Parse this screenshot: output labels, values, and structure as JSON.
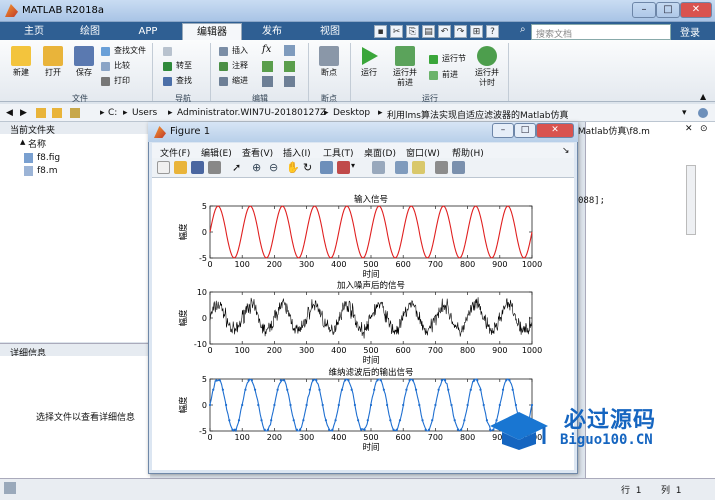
{
  "window": {
    "title": "MATLAB R2018a"
  },
  "search": {
    "placeholder": "搜索文档"
  },
  "login": "登录",
  "tabs": [
    {
      "label": "主页"
    },
    {
      "label": "绘图"
    },
    {
      "label": "APP"
    },
    {
      "label": "编辑器"
    },
    {
      "label": "发布"
    },
    {
      "label": "视图"
    }
  ],
  "ribbon": {
    "file": {
      "new": "新建",
      "open": "打开",
      "save": "保存",
      "find_files": "查找文件",
      "compare": "比较",
      "print": "打印",
      "group": "文件"
    },
    "nav": {
      "goto": "转至",
      "find": "查找",
      "group": "导航"
    },
    "edit": {
      "insert": "插入",
      "comment": "注释",
      "indent": "缩进",
      "fx": "fx",
      "group": "编辑"
    },
    "breakpoints": {
      "label": "断点",
      "group": "断点"
    },
    "run": {
      "run": "运行",
      "run_advance": "运行并\n前进",
      "run_section": "运行节",
      "advance": "前进",
      "run_time": "运行并\n计时",
      "group": "运行"
    }
  },
  "address": {
    "crumbs": [
      "C:",
      "Users",
      "Administrator.WIN7U-20180127Z",
      "Desktop",
      "利用lms算法实现自适应滤波器的Matlab仿真"
    ]
  },
  "left_pane": {
    "title": "当前文件夹",
    "name_header": "名称",
    "files": [
      "f8.fig",
      "f8.m"
    ]
  },
  "detail": {
    "title": "详细信息",
    "text": "选择文件以查看详细信息"
  },
  "editor": {
    "tab": "◎Matlab仿真\\f8.m",
    "code_fragment": "088];"
  },
  "status": {
    "row_label": "行",
    "row": "1",
    "col_label": "列",
    "col": "1"
  },
  "figure": {
    "title": "Figure 1",
    "menus": [
      "文件(F)",
      "编辑(E)",
      "查看(V)",
      "插入(I)",
      "工具(T)",
      "桌面(D)",
      "窗口(W)",
      "帮助(H)"
    ]
  },
  "chart_data": [
    {
      "type": "line",
      "title": "输入信号",
      "xlabel": "时间",
      "ylabel": "幅度",
      "xlim": [
        0,
        1000
      ],
      "ylim": [
        -5,
        5
      ],
      "xticks": [
        "0",
        "100",
        "200",
        "300",
        "400",
        "500",
        "600",
        "700",
        "800",
        "900",
        "1000"
      ],
      "yticks": [
        "5",
        "0",
        "-5"
      ],
      "series": [
        {
          "color": "#e02020",
          "amplitude": 5,
          "period": 100,
          "noise": 0
        }
      ]
    },
    {
      "type": "line",
      "title": "加入噪声后的信号",
      "xlabel": "时间",
      "ylabel": "幅度",
      "xlim": [
        0,
        1000
      ],
      "ylim": [
        -10,
        10
      ],
      "xticks": [
        "0",
        "100",
        "200",
        "300",
        "400",
        "500",
        "600",
        "700",
        "800",
        "900",
        "1000"
      ],
      "yticks": [
        "10",
        "0",
        "-10"
      ],
      "series": [
        {
          "color": "#000000",
          "amplitude": 5,
          "period": 100,
          "noise": 2.5
        }
      ]
    },
    {
      "type": "line",
      "title": "维纳滤波后的输出信号",
      "xlabel": "时间",
      "ylabel": "幅度",
      "xlim": [
        0,
        1000
      ],
      "ylim": [
        -5,
        5
      ],
      "xticks": [
        "0",
        "100",
        "200",
        "300",
        "400",
        "500",
        "600",
        "700",
        "800",
        "900",
        "1000"
      ],
      "yticks": [
        "5",
        "0",
        "-5"
      ],
      "series": [
        {
          "color": "#1f6fd0",
          "amplitude": 5,
          "period": 100,
          "noise": 0.3
        }
      ]
    }
  ],
  "watermark": {
    "cn": "必过源码",
    "en": "Biguo100.CN"
  },
  "colors": {
    "tab_bar": "#2f5f93",
    "accent": "#1565c0"
  }
}
